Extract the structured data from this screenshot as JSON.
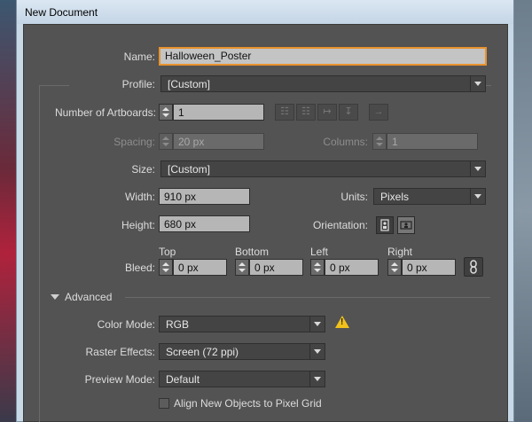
{
  "window": {
    "title": "New Document"
  },
  "name": {
    "label": "Name:",
    "value": "Halloween_Poster"
  },
  "profile": {
    "label": "Profile:",
    "value": "[Custom]"
  },
  "artboards": {
    "label": "Number of Artboards:",
    "value": "1"
  },
  "artboard_layout_icons": [
    "grid-by-row-icon",
    "grid-by-column-icon",
    "arrange-by-row-icon",
    "arrange-by-column-icon",
    "right-to-left-icon"
  ],
  "spacing": {
    "label": "Spacing:",
    "value": "20 px"
  },
  "columns": {
    "label": "Columns:",
    "value": "1"
  },
  "size": {
    "label": "Size:",
    "value": "[Custom]"
  },
  "width": {
    "label": "Width:",
    "value": "910 px"
  },
  "units": {
    "label": "Units:",
    "value": "Pixels"
  },
  "height": {
    "label": "Height:",
    "value": "680 px"
  },
  "orientation": {
    "label": "Orientation:",
    "selected": "portrait"
  },
  "bleed": {
    "label": "Bleed:",
    "top": {
      "label": "Top",
      "value": "0 px"
    },
    "bottom": {
      "label": "Bottom",
      "value": "0 px"
    },
    "left": {
      "label": "Left",
      "value": "0 px"
    },
    "right": {
      "label": "Right",
      "value": "0 px"
    }
  },
  "advanced": {
    "label": "Advanced"
  },
  "color_mode": {
    "label": "Color Mode:",
    "value": "RGB"
  },
  "raster_effects": {
    "label": "Raster Effects:",
    "value": "Screen (72 ppi)"
  },
  "preview_mode": {
    "label": "Preview Mode:",
    "value": "Default"
  },
  "align_pixel_grid": {
    "label": "Align New Objects to Pixel Grid",
    "checked": false
  },
  "colors": {
    "dialog_bg": "#535353",
    "focus": "#e8922e",
    "warning": "#f2c21b"
  }
}
